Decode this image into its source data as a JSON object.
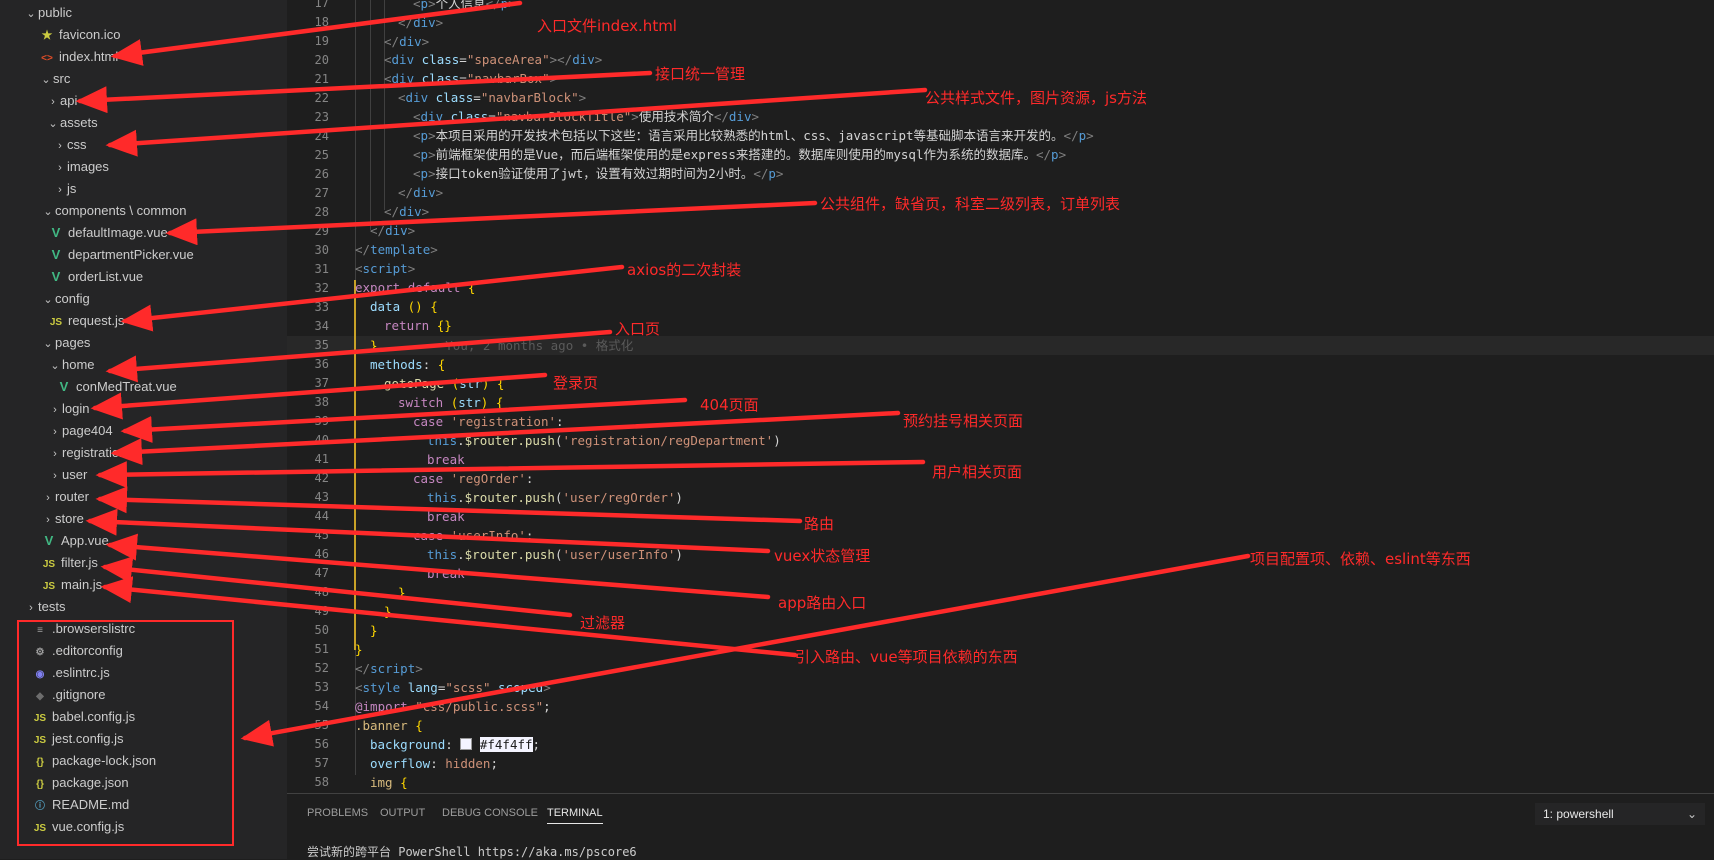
{
  "explorer": {
    "items": [
      {
        "label": "public",
        "chevron": "down",
        "icon": ""
      },
      {
        "label": "favicon.ico",
        "chevron": "",
        "icon": "★"
      },
      {
        "label": "index.html",
        "chevron": "",
        "icon": "<>"
      },
      {
        "label": "src",
        "chevron": "down",
        "icon": ""
      },
      {
        "label": "api",
        "chevron": "right",
        "icon": ""
      },
      {
        "label": "assets",
        "chevron": "down",
        "icon": ""
      },
      {
        "label": "css",
        "chevron": "right",
        "icon": ""
      },
      {
        "label": "images",
        "chevron": "right",
        "icon": ""
      },
      {
        "label": "js",
        "chevron": "right",
        "icon": ""
      },
      {
        "label": "components \\ common",
        "chevron": "down",
        "icon": ""
      },
      {
        "label": "defaultImage.vue",
        "chevron": "",
        "icon": "V"
      },
      {
        "label": "departmentPicker.vue",
        "chevron": "",
        "icon": "V"
      },
      {
        "label": "orderList.vue",
        "chevron": "",
        "icon": "V"
      },
      {
        "label": "config",
        "chevron": "down",
        "icon": ""
      },
      {
        "label": "request.js",
        "chevron": "",
        "icon": "JS"
      },
      {
        "label": "pages",
        "chevron": "down",
        "icon": ""
      },
      {
        "label": "home",
        "chevron": "down",
        "icon": ""
      },
      {
        "label": "conMedTreat.vue",
        "chevron": "",
        "icon": "V"
      },
      {
        "label": "login",
        "chevron": "right",
        "icon": ""
      },
      {
        "label": "page404",
        "chevron": "right",
        "icon": ""
      },
      {
        "label": "registration",
        "chevron": "right",
        "icon": ""
      },
      {
        "label": "user",
        "chevron": "right",
        "icon": ""
      },
      {
        "label": "router",
        "chevron": "right",
        "icon": ""
      },
      {
        "label": "store",
        "chevron": "right",
        "icon": ""
      },
      {
        "label": "App.vue",
        "chevron": "",
        "icon": "V"
      },
      {
        "label": "filter.js",
        "chevron": "",
        "icon": "JS"
      },
      {
        "label": "main.js",
        "chevron": "",
        "icon": "JS"
      },
      {
        "label": "tests",
        "chevron": "right",
        "icon": ""
      },
      {
        "label": ".browserslistrc",
        "chevron": "",
        "icon": "≡"
      },
      {
        "label": ".editorconfig",
        "chevron": "",
        "icon": "⚙"
      },
      {
        "label": ".eslintrc.js",
        "chevron": "",
        "icon": "◉"
      },
      {
        "label": ".gitignore",
        "chevron": "",
        "icon": "◆"
      },
      {
        "label": "babel.config.js",
        "chevron": "",
        "icon": "JS"
      },
      {
        "label": "jest.config.js",
        "chevron": "",
        "icon": "JS"
      },
      {
        "label": "package-lock.json",
        "chevron": "",
        "icon": "{}"
      },
      {
        "label": "package.json",
        "chevron": "",
        "icon": "{}"
      },
      {
        "label": "README.md",
        "chevron": "",
        "icon": "ⓘ"
      },
      {
        "label": "vue.config.js",
        "chevron": "",
        "icon": "JS"
      }
    ]
  },
  "editor": {
    "line_numbers": [
      "17",
      "18",
      "19",
      "20",
      "21",
      "22",
      "23",
      "24",
      "25",
      "26",
      "27",
      "28",
      "29",
      "30",
      "31",
      "32",
      "33",
      "34",
      "35",
      "36",
      "37",
      "38",
      "39",
      "40",
      "41",
      "42",
      "43",
      "44",
      "45",
      "46",
      "47",
      "48",
      "49",
      "50",
      "51",
      "52",
      "53",
      "54",
      "55",
      "56",
      "57",
      "58"
    ],
    "tokens": {
      "p": "p",
      "div": "div",
      "class": "class",
      "template": "template",
      "script": "script",
      "style": "style",
      "l17_text": "个人信息",
      "l20_val": "\"spaceArea\"",
      "l21_val": "\"navbarBox\"",
      "l22_val": "\"navbarBlock\"",
      "l23_val": "\"navbarBlockTitle\"",
      "l23_text": "使用技术简介",
      "l24_text": "本项目采用的开发技术包括以下这些：语言采用比较熟悉的html、css、javascript等基础脚本语言来开发的。",
      "l25_text": "前端框架使用的是Vue，而后端框架使用的是express来搭建的。数据库则使用的mysql作为系统的数据库。",
      "l26_text": "接口token验证使用了jwt，设置有效过期时间为2小时。",
      "export": "export",
      "default": "default",
      "brace_open": "{",
      "data": "data",
      "return": "return",
      "blame": "You, 2 months ago • 格式化",
      "methods": "methods",
      "gotoPage": "gotoPage",
      "str": "str",
      "switch": "switch",
      "case": "case",
      "break": "break",
      "this": "this",
      "router_push": "$router.push",
      "reg": "'registration'",
      "reg_path": "'registration/regDepartment'",
      "regOrder": "'regOrder'",
      "regOrder_path": "'user/regOrder'",
      "userInfo": "'userInfo'",
      "userInfo_path": "'user/userInfo'",
      "lang": "lang",
      "scss": "\"scss\"",
      "scoped": "scoped",
      "import": "@import",
      "import_path": "\"css/public.scss\"",
      "banner": ".banner",
      "background": "background",
      "bg_val": "#f4f4ff",
      "overflow": "overflow",
      "hidden": "hidden",
      "img": "img"
    }
  },
  "panel": {
    "tabs": [
      "PROBLEMS",
      "OUTPUT",
      "DEBUG CONSOLE",
      "TERMINAL"
    ],
    "terminal_select": "1: powershell",
    "terminal_line": "尝试新的跨平台 PowerShell https://aka.ms/pscore6"
  },
  "annotations": [
    "入口文件index.html",
    "接口统一管理",
    "公共样式文件，图片资源，js方法",
    "公共组件，缺省页，科室二级列表，订单列表",
    "axios的二次封装",
    "入口页",
    "登录页",
    "404页面",
    "预约挂号相关页面",
    "用户相关页面",
    "路由",
    "vuex状态管理",
    "app路由入口",
    "过滤器",
    "引入路由、vue等项目依赖的东西",
    "项目配置项、依赖、eslint等东西"
  ],
  "colors": {
    "annotation": "#ff2a2a",
    "editor_bg": "#1e1e1e",
    "sidebar_bg": "#252526"
  }
}
